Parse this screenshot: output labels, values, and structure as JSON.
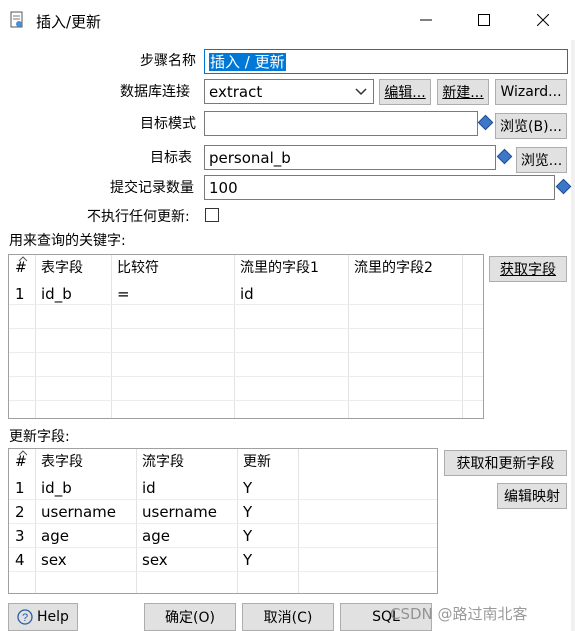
{
  "window": {
    "title": "插入/更新",
    "icons": {
      "app": "document-gear-icon",
      "minimize": "minimize-icon",
      "maximize": "maximize-icon",
      "close": "close-icon"
    }
  },
  "form": {
    "step_name_label": "步骤名称",
    "step_name_value": "插入 / 更新",
    "connection_label": "数据库连接",
    "connection_value": "extract",
    "edit_button": "编辑...",
    "new_button": "新建...",
    "wizard_button": "Wizard...",
    "schema_label": "目标模式",
    "schema_value": "",
    "browse_schema_button": "浏览(B)...",
    "table_label": "目标表",
    "table_value": "personal_b",
    "browse_table_button": "浏览...",
    "commit_label": "提交记录数量",
    "commit_value": "100",
    "no_update_label": "不执行任何更新:"
  },
  "keys_section": {
    "label": "用来查询的关键字:",
    "columns": [
      "#",
      "表字段",
      "比较符",
      "流里的字段1",
      "流里的字段2"
    ],
    "rows": [
      [
        "1",
        "id_b",
        "=",
        "id",
        ""
      ]
    ],
    "get_fields_button": "获取字段"
  },
  "update_section": {
    "label": "更新字段:",
    "columns": [
      "#",
      "表字段",
      "流字段",
      "更新"
    ],
    "rows": [
      [
        "1",
        "id_b",
        "id",
        "Y"
      ],
      [
        "2",
        "username",
        "username",
        "Y"
      ],
      [
        "3",
        "age",
        "age",
        "Y"
      ],
      [
        "4",
        "sex",
        "sex",
        "Y"
      ]
    ],
    "get_update_fields_button": "获取和更新字段",
    "edit_mapping_button": "编辑映射"
  },
  "footer": {
    "help_button": "Help",
    "ok_button": "确定(O)",
    "cancel_button": "取消(C)",
    "sql_button": "SQL"
  },
  "watermark": "CSDN @路过南北客"
}
